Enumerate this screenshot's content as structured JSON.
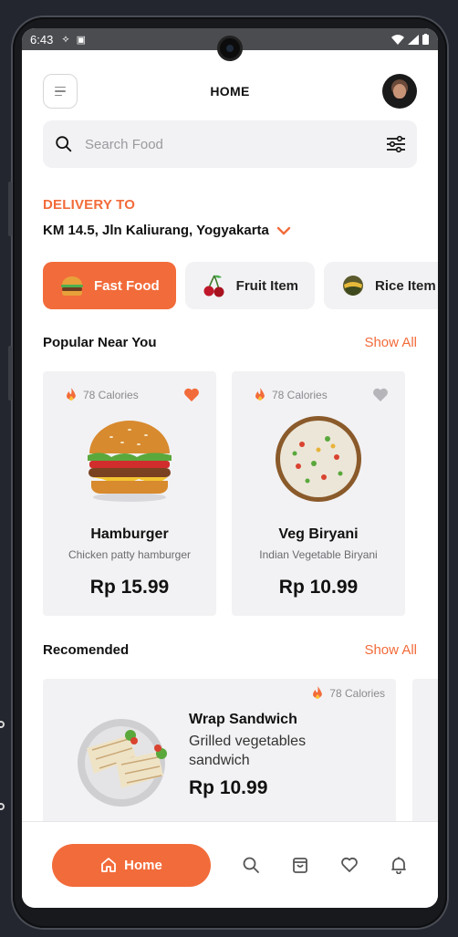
{
  "status": {
    "time": "6:43"
  },
  "header": {
    "title": "HOME"
  },
  "search": {
    "placeholder": "Search Food"
  },
  "delivery": {
    "label": "DELIVERY TO",
    "address": "KM 14.5, Jln Kaliurang, Yogyakarta"
  },
  "categories": [
    {
      "label": "Fast Food",
      "icon": "burger-icon",
      "active": true
    },
    {
      "label": "Fruit Item",
      "icon": "cherry-icon",
      "active": false
    },
    {
      "label": "Rice Item",
      "icon": "rice-icon",
      "active": false
    }
  ],
  "popular": {
    "title": "Popular Near You",
    "show_all": "Show All",
    "items": [
      {
        "calories": "78 Calories",
        "name": "Hamburger",
        "desc": "Chicken patty hamburger",
        "price": "Rp 15.99",
        "favorite": true
      },
      {
        "calories": "78 Calories",
        "name": "Veg Biryani",
        "desc": "Indian Vegetable Biryani",
        "price": "Rp 10.99",
        "favorite": false
      }
    ]
  },
  "recommended": {
    "title": "Recomended",
    "show_all": "Show All",
    "items": [
      {
        "calories": "78 Calories",
        "name": "Wrap Sandwich",
        "desc": "Grilled vegetables sandwich",
        "price": "Rp 10.99"
      }
    ]
  },
  "nav": {
    "home_label": "Home",
    "icons": [
      "home-icon",
      "search-icon",
      "bag-icon",
      "heart-icon",
      "bell-icon"
    ]
  },
  "colors": {
    "accent": "#f26b3a",
    "card_bg": "#f2f2f4",
    "text": "#111111"
  }
}
